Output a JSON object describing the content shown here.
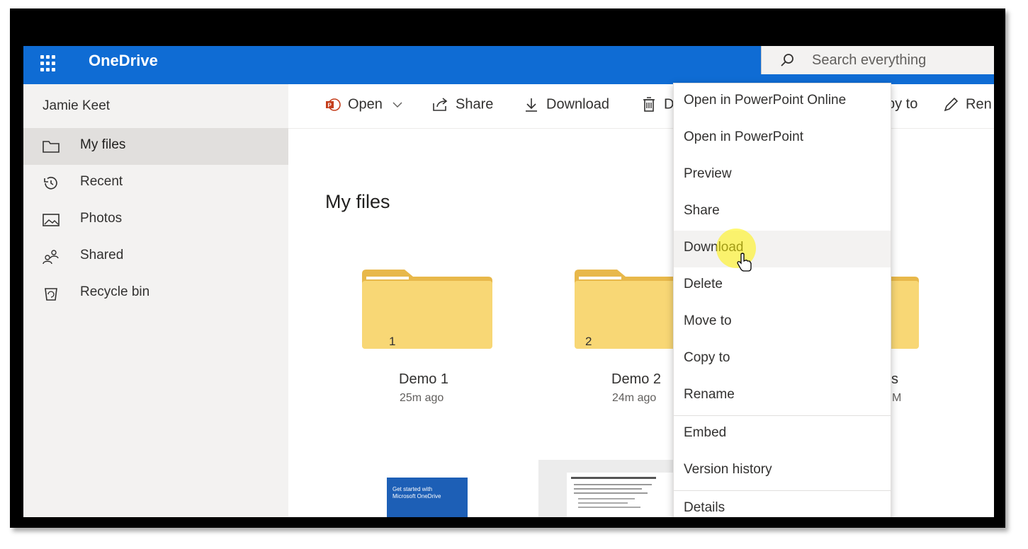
{
  "app": {
    "name": "OneDrive"
  },
  "search": {
    "placeholder": "Search everything"
  },
  "sidebar": {
    "user": "Jamie Keet",
    "items": [
      {
        "label": "My files",
        "icon": "folder-icon",
        "active": true
      },
      {
        "label": "Recent",
        "icon": "history-icon",
        "active": false
      },
      {
        "label": "Photos",
        "icon": "photo-icon",
        "active": false
      },
      {
        "label": "Shared",
        "icon": "shared-people-icon",
        "active": false
      },
      {
        "label": "Recycle bin",
        "icon": "recycle-bin-icon",
        "active": false
      }
    ]
  },
  "toolbar": {
    "open": "Open",
    "share": "Share",
    "download": "Download",
    "delete_partial": "D",
    "copy_partial": "py to",
    "rename_partial": "Ren"
  },
  "main": {
    "title": "My files",
    "folders": [
      {
        "name": "Demo 1",
        "count": "1",
        "modified": "25m ago"
      },
      {
        "name": "Demo 2",
        "count": "2",
        "modified": "24m ago"
      },
      {
        "name_partial": "s",
        "modified_partial": "M"
      }
    ],
    "thumb_text": "Get started with Microsoft OneDrive"
  },
  "context_menu": {
    "items": [
      "Open in PowerPoint Online",
      "Open in PowerPoint",
      "Preview",
      "Share",
      "Download",
      "Delete",
      "Move to",
      "Copy to",
      "Rename",
      "Embed",
      "Version history",
      "Details"
    ],
    "hovered": "Download"
  },
  "colors": {
    "brand": "#0f6cd4",
    "folder": "#f8d775",
    "folder_tab": "#e8b84a",
    "highlight": "#fff200"
  }
}
